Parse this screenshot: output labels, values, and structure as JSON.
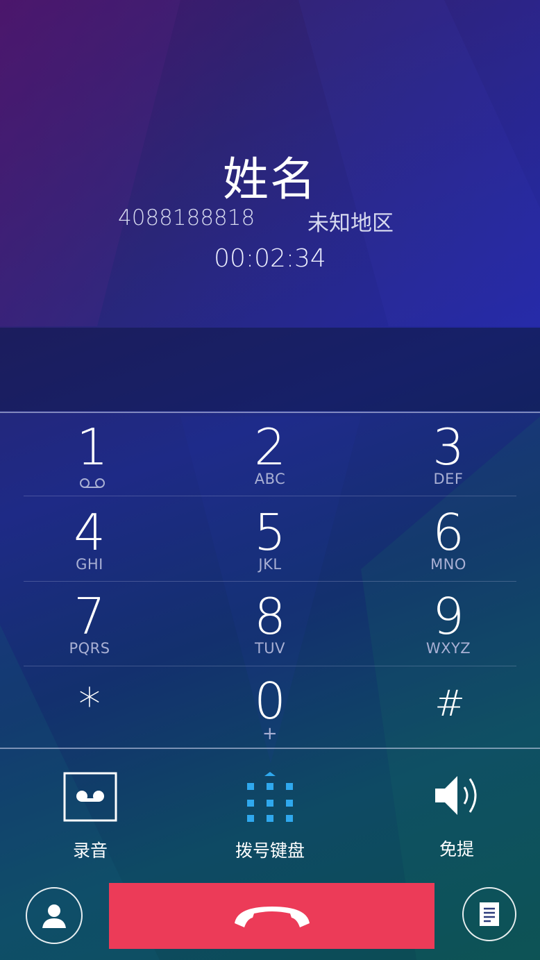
{
  "caller": {
    "name": "姓名",
    "number": "4088188818",
    "region": "未知地区",
    "duration": "00:02:34"
  },
  "keypad": {
    "keys": [
      {
        "digit": "1",
        "letters": ""
      },
      {
        "digit": "2",
        "letters": "ABC"
      },
      {
        "digit": "3",
        "letters": "DEF"
      },
      {
        "digit": "4",
        "letters": "GHI"
      },
      {
        "digit": "5",
        "letters": "JKL"
      },
      {
        "digit": "6",
        "letters": "MNO"
      },
      {
        "digit": "7",
        "letters": "PQRS"
      },
      {
        "digit": "8",
        "letters": "TUV"
      },
      {
        "digit": "9",
        "letters": "WXYZ"
      },
      {
        "digit": "*",
        "letters": ""
      },
      {
        "digit": "0",
        "letters": "+"
      },
      {
        "digit": "#",
        "letters": ""
      }
    ]
  },
  "actions": {
    "record_label": "录音",
    "dialpad_label": "拨号键盘",
    "speaker_label": "免提"
  },
  "icons": {
    "voicemail": "voicemail-icon",
    "record": "record-icon",
    "dialpad": "dialpad-icon",
    "speaker": "speaker-icon",
    "contacts": "contact-icon",
    "notes": "notes-icon",
    "end_call": "end-call-icon"
  },
  "colors": {
    "end_call": "#ec3b58",
    "dialpad_accent": "#2fa8ee"
  }
}
